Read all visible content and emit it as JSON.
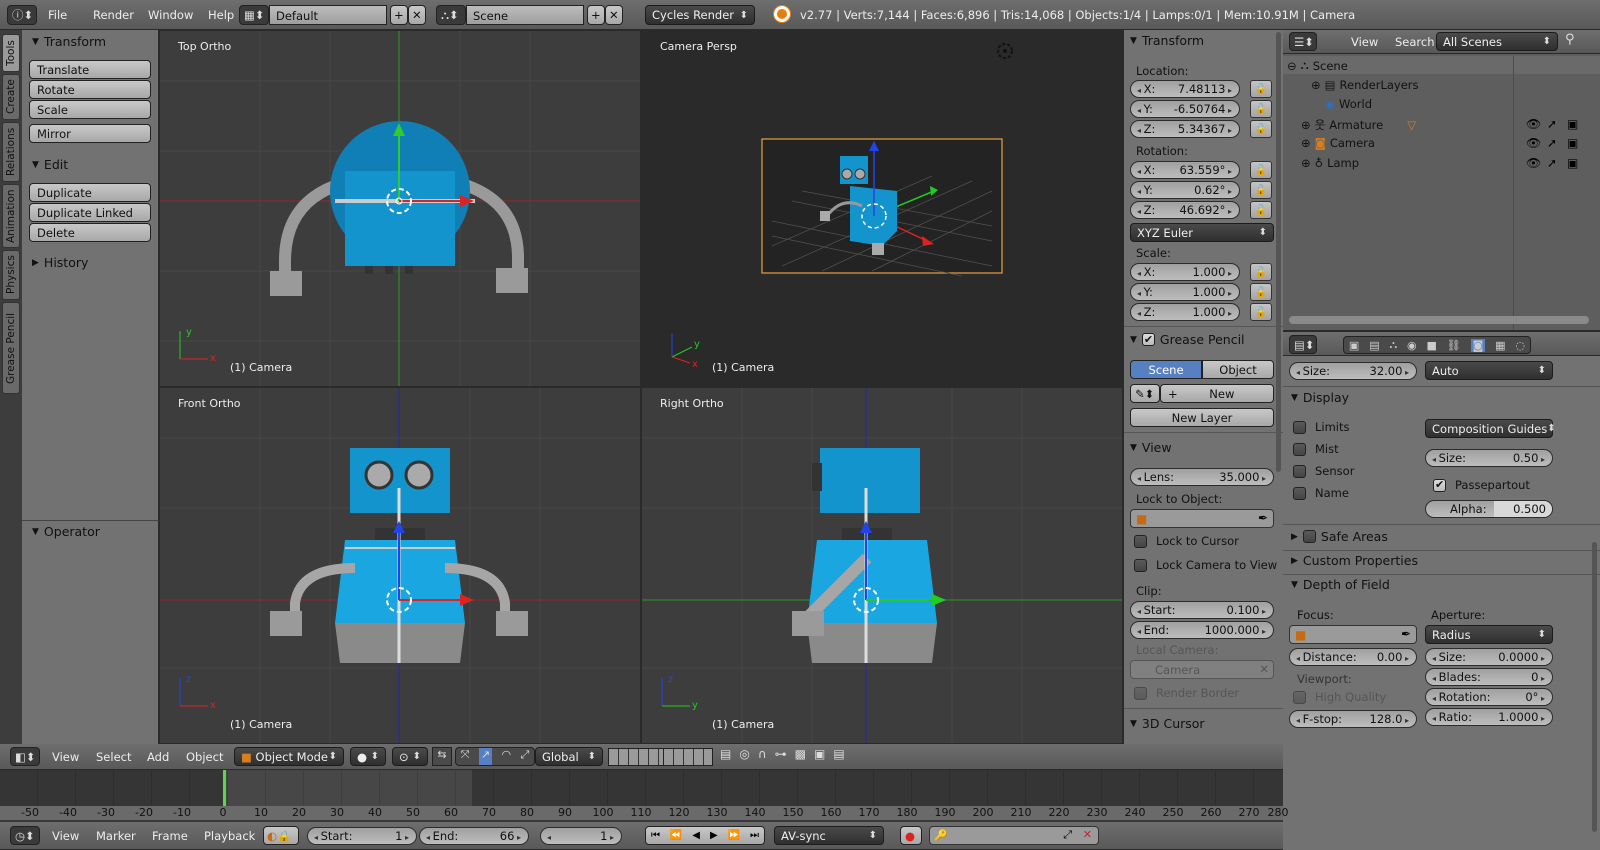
{
  "topbar": {
    "menu": [
      "File",
      "Render",
      "Window",
      "Help"
    ],
    "layout": "Default",
    "scene": "Scene",
    "engine": "Cycles Render",
    "stats": "v2.77 | Verts:7,144 | Faces:6,896 | Tris:14,068 | Objects:1/4 | Lamps:0/1 | Mem:10.91M | Camera"
  },
  "tool_tabs": [
    "Tools",
    "Create",
    "Relations",
    "Animation",
    "Physics",
    "Grease Pencil"
  ],
  "toolshelf": {
    "transform_title": "Transform",
    "transform_buttons": [
      "Translate",
      "Rotate",
      "Scale"
    ],
    "mirror": "Mirror",
    "edit_title": "Edit",
    "edit_buttons": [
      "Duplicate",
      "Duplicate Linked",
      "Delete"
    ],
    "history": "History",
    "operator": "Operator"
  },
  "viewports": [
    {
      "name": "Top Ortho",
      "footer": "(1) Camera"
    },
    {
      "name": "Camera Persp",
      "footer": "(1) Camera"
    },
    {
      "name": "Front Ortho",
      "footer": "(1) Camera"
    },
    {
      "name": "Right Ortho",
      "footer": "(1) Camera"
    }
  ],
  "axis_letters": {
    "x": "x",
    "y": "y",
    "z": "z"
  },
  "npanel": {
    "transform": "Transform",
    "location": "Location:",
    "loc": [
      {
        "k": "X:",
        "v": "7.48113"
      },
      {
        "k": "Y:",
        "v": "-6.50764"
      },
      {
        "k": "Z:",
        "v": "5.34367"
      }
    ],
    "rotation": "Rotation:",
    "rot": [
      {
        "k": "X:",
        "v": "63.559°"
      },
      {
        "k": "Y:",
        "v": "0.62°"
      },
      {
        "k": "Z:",
        "v": "46.692°"
      }
    ],
    "rot_mode": "XYZ Euler",
    "scale": "Scale:",
    "scl": [
      {
        "k": "X:",
        "v": "1.000"
      },
      {
        "k": "Y:",
        "v": "1.000"
      },
      {
        "k": "Z:",
        "v": "1.000"
      }
    ],
    "grease": "Grease Pencil",
    "gp_scene": "Scene",
    "gp_object": "Object",
    "gp_new": "New",
    "gp_newlayer": "New Layer",
    "view": "View",
    "lens_k": "Lens:",
    "lens_v": "35.000",
    "lock_obj": "Lock to Object:",
    "lock_cursor": "Lock to Cursor",
    "lock_cam": "Lock Camera to View",
    "clip": "Clip:",
    "clip_start_k": "Start:",
    "clip_start_v": "0.100",
    "clip_end_k": "End:",
    "clip_end_v": "1000.000",
    "local_cam": "Local Camera:",
    "local_cam_val": "Camera",
    "render_border": "Render Border",
    "cursor": "3D Cursor"
  },
  "outliner": {
    "menu": [
      "View",
      "Search"
    ],
    "filter": "All Scenes",
    "items": [
      "Scene",
      "RenderLayers",
      "World",
      "Armature",
      "Camera",
      "Lamp"
    ]
  },
  "props": {
    "size_k": "Size:",
    "size_v": "32.00",
    "size_mode": "Auto",
    "display": "Display",
    "limits": "Limits",
    "mist": "Mist",
    "sensor": "Sensor",
    "name": "Name",
    "guides": "Composition Guides",
    "dsize_k": "Size:",
    "dsize_v": "0.50",
    "passepartout": "Passepartout",
    "alpha_k": "Alpha:",
    "alpha_v": "0.500",
    "safe": "Safe Areas",
    "custom": "Custom Properties",
    "dof": "Depth of Field",
    "focus": "Focus:",
    "aperture": "Aperture:",
    "radius": "Radius",
    "dist_k": "Distance:",
    "dist_v": "0.00",
    "asize_k": "Size:",
    "asize_v": "0.0000",
    "blades_k": "Blades:",
    "blades_v": "0",
    "viewport": "Viewport:",
    "hq": "High Quality",
    "rotation_k": "Rotation:",
    "rotation_v": "0°",
    "fstop_k": "F-stop:",
    "fstop_v": "128.0",
    "ratio_k": "Ratio:",
    "ratio_v": "1.0000"
  },
  "view3d_header": {
    "menu": [
      "View",
      "Select",
      "Add",
      "Object"
    ],
    "mode": "Object Mode",
    "orientation": "Global"
  },
  "timeline": {
    "ticks": [
      "-50",
      "-40",
      "-30",
      "-20",
      "-10",
      "0",
      "10",
      "20",
      "30",
      "40",
      "50",
      "60",
      "70",
      "80",
      "90",
      "100",
      "110",
      "120",
      "130",
      "140",
      "150",
      "160",
      "170",
      "180",
      "190",
      "200",
      "210",
      "220",
      "230",
      "240",
      "250",
      "260",
      "270",
      "280"
    ],
    "menu": [
      "View",
      "Marker",
      "Frame",
      "Playback"
    ],
    "start_k": "Start:",
    "start_v": "1",
    "end_k": "End:",
    "end_v": "66",
    "current": "1",
    "sync": "AV-sync"
  }
}
